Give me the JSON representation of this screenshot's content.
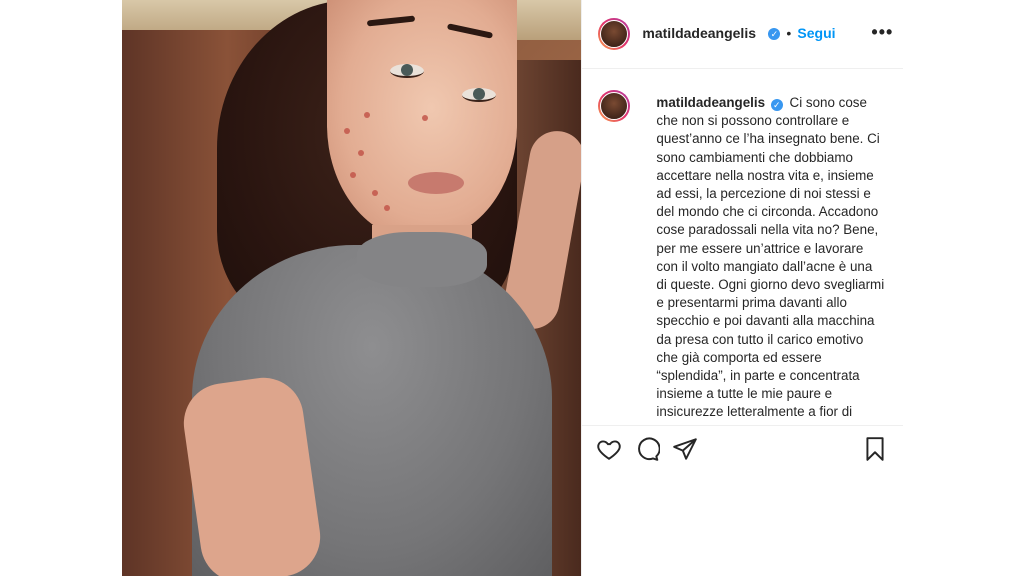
{
  "post": {
    "username": "matildadeangelis",
    "verified": true,
    "dot": "•",
    "follow_label": "Segui",
    "more_label": "•••",
    "caption": {
      "username": "matildadeangelis",
      "text": "Ci sono cose che non si possono controllare e quest’anno ce l’ha insegnato bene. Ci sono cambiamenti che dobbiamo accettare nella nostra vita e, insieme ad essi, la percezione di noi stessi e del mondo che ci circonda. Accadono cose paradossali nella vita no? Bene, per me essere un’attrice e lavorare con il volto mangiato dall’acne è una di queste. Ogni giorno devo svegliarmi e presentarmi prima davanti allo specchio e poi davanti alla macchina da presa con tutto il carico emotivo che già comporta ed essere “splendida”, in parte e concentrata insieme a tutte le mie paure e insicurezze letteralmente a fior di pelle. Ci sono problemi ben più grandi nella vita, ne sono consapevole, ma volevo"
    }
  },
  "icons": {
    "like": "heart-icon",
    "comment": "comment-icon",
    "share": "share-icon",
    "save": "bookmark-icon"
  },
  "colors": {
    "follow": "#0095f6",
    "verified": "#3897f0",
    "text": "#262626",
    "border": "#efefef"
  }
}
